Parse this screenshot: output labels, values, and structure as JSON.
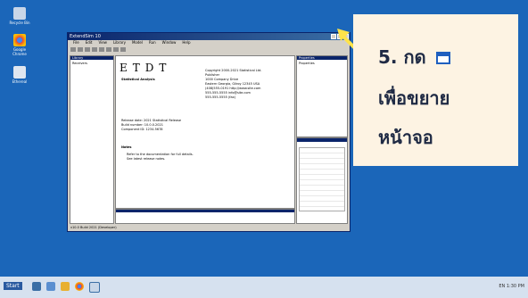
{
  "desktop": {
    "icons": [
      {
        "label": "Recycle Bin",
        "icon": "recycle-bin-icon",
        "color": "#c8d6e8"
      },
      {
        "label": "Google Chrome",
        "icon": "chrome-icon",
        "color": "#e8b030"
      },
      {
        "label": "Ethereal",
        "icon": "app-icon",
        "color": "#dfe6f0"
      }
    ]
  },
  "window": {
    "title": "ExtendSim 10",
    "menu": [
      "File",
      "Edit",
      "View",
      "Library",
      "Model",
      "Run",
      "Window",
      "Help"
    ],
    "left_pane": {
      "tab": "Library",
      "line1": "Receivers"
    },
    "right_pane": {
      "title": "Properties",
      "line1": "Properties"
    },
    "document": {
      "brand": "ETDT",
      "subtitle": "Statistical Analysis",
      "address_lines": [
        "Copyright 2000-2021 Statistical Ltd.",
        "Publisher",
        "1000 Company Drive",
        "Eastern Georgia, Gilroy 12345 USA",
        "(408)555-0191 http://www.site.com",
        "555-555-5555 info@site.com",
        "555-555-5555 (fax)"
      ],
      "version_lines": [
        "Release date: 2021 Statistical Release",
        "Build number: 10.0.0.2021",
        "Component ID: 1234-5678"
      ],
      "section": "Notes",
      "bullets": [
        "Refer to the documentation for full details.",
        "See latest release notes."
      ]
    },
    "status": "v10.0 Build 2021 (Developer)"
  },
  "callout": {
    "line1": "5. กด",
    "line2": "เพื่อขยาย",
    "line3": "หน้าจอ",
    "accent": "#ffe08a",
    "text_color": "#1f2a44"
  },
  "taskbar": {
    "start": "Start",
    "tray": "EN  1:30 PM"
  }
}
